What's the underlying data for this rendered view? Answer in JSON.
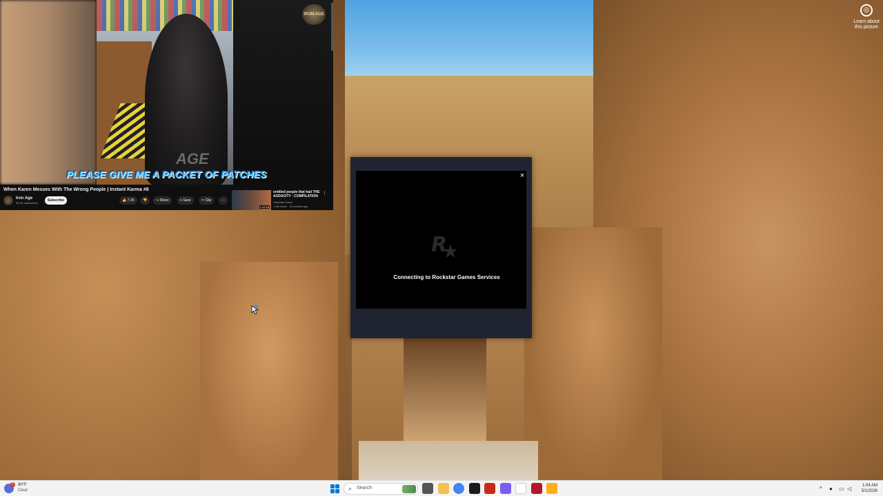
{
  "desktop": {
    "learn_more": "Learn about this picture"
  },
  "youtube": {
    "caption": "PLEASE GIVE ME A PACKET OF PATCHES",
    "watermark": "AGE",
    "channel_logo": "IRON AGE",
    "title": "When Karen Messes With The Wrong People | Instant Karma #8",
    "channel_name": "Iron Age",
    "subscribers": "35.3K subscribers",
    "subscribe_label": "Subscribe",
    "like_count": "7.3K",
    "share_label": "Share",
    "save_label": "Save",
    "clip_label": "Clip",
    "more_label": "···",
    "recommended": {
      "title": "entitled people that had THE AUDACITY - COMPILATION",
      "channel": "Charlotte Dobre",
      "meta": "1.4M views · 10 months ago",
      "duration": "1:12:18"
    }
  },
  "rockstar": {
    "close": "×",
    "status": "Connecting to Rockstar Games Services"
  },
  "taskbar": {
    "weather_temp": "80°F",
    "weather_cond": "Clear",
    "weather_badge": "1",
    "search_placeholder": "Search",
    "time": "1:04 AM",
    "date": "5/1/2026",
    "apps": [
      {
        "name": "file-icon",
        "color": "#555555"
      },
      {
        "name": "file-explorer-icon",
        "color": "#f2c14e"
      },
      {
        "name": "chrome-icon",
        "color": "#4285f4"
      },
      {
        "name": "app-icon",
        "color": "#1b1b1b"
      },
      {
        "name": "app-icon",
        "color": "#c42b1c"
      },
      {
        "name": "messenger-icon",
        "color": "#7b5cf5"
      },
      {
        "name": "notepad-icon",
        "color": "#ffffff"
      },
      {
        "name": "app-icon",
        "color": "#b4162a"
      },
      {
        "name": "rockstar-icon",
        "color": "#fcaf17"
      }
    ]
  }
}
